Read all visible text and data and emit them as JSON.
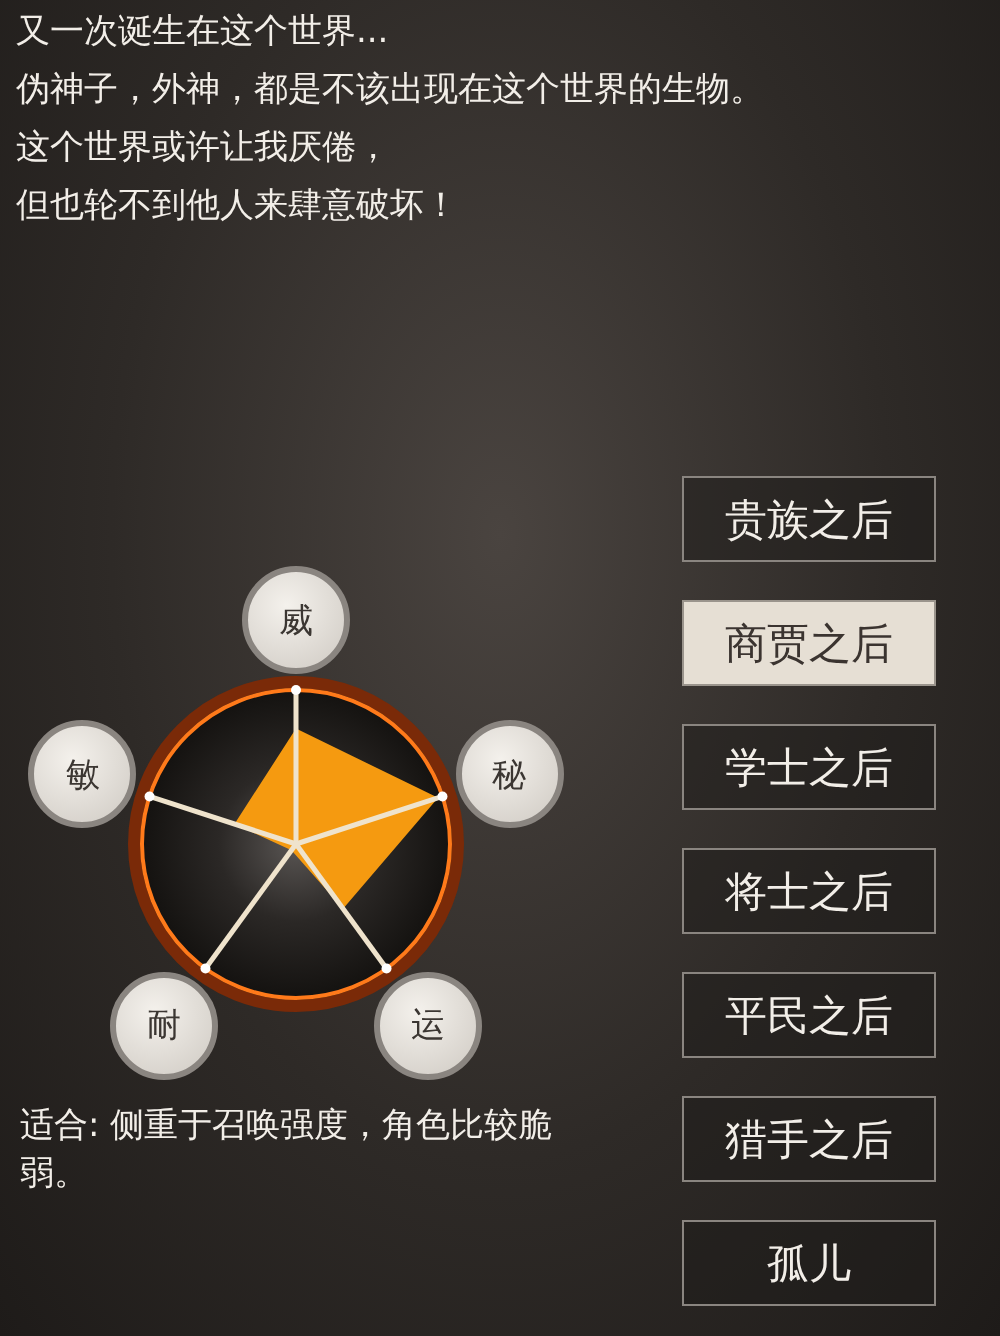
{
  "intro_lines": [
    "又一次诞生在这个世界...",
    "伪神子，外神，都是不该出现在这个世界的生物。",
    "这个世界或许让我厌倦，",
    "但也轮不到他人来肆意破坏！"
  ],
  "stats": [
    {
      "label": "威"
    },
    {
      "label": "秘"
    },
    {
      "label": "运"
    },
    {
      "label": "耐"
    },
    {
      "label": "敏"
    }
  ],
  "description": "适合: 侧重于召唤强度，角色比较脆弱。",
  "origins": [
    {
      "label": "贵族之后",
      "selected": false
    },
    {
      "label": "商贾之后",
      "selected": true
    },
    {
      "label": "学士之后",
      "selected": false
    },
    {
      "label": "将士之后",
      "selected": false
    },
    {
      "label": "平民之后",
      "selected": false
    },
    {
      "label": "猎手之后",
      "selected": false
    },
    {
      "label": "孤儿",
      "selected": false
    }
  ]
}
